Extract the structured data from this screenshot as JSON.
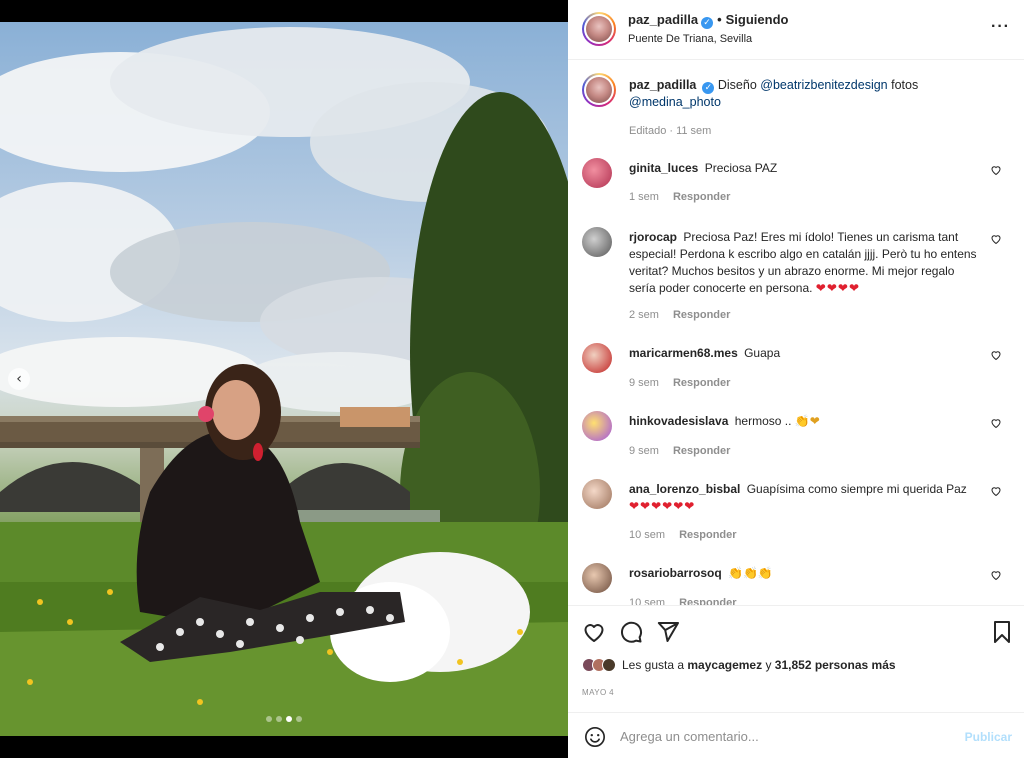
{
  "post": {
    "username": "paz_padilla",
    "following_label": "Siguiendo",
    "location": "Puente De Triana, Sevilla",
    "separator": "•"
  },
  "caption": {
    "username": "paz_padilla",
    "text_pre": "Diseño",
    "mention1": "@beatrizbenitezdesign",
    "text_mid": "fotos",
    "mention2": "@medina_photo",
    "meta": "Editado · 11 sem"
  },
  "comments": [
    {
      "username": "ginita_luces",
      "text": "Preciosa PAZ",
      "extra": "",
      "time": "1 sem",
      "reply": "Responder"
    },
    {
      "username": "rjorocap",
      "text": "Preciosa Paz! Eres mi ídolo! Tienes un carisma tant especial! Perdona k escribo algo en catalán jjjj. Però tu ho entens veritat? Muchos besitos y un abrazo enorme. Mi mejor regalo sería poder conocerte en persona.",
      "extra": "❤❤❤❤",
      "time": "2 sem",
      "reply": "Responder"
    },
    {
      "username": "maricarmen68.mes",
      "text": "Guapa",
      "extra": "",
      "time": "9 sem",
      "reply": "Responder"
    },
    {
      "username": "hinkovadesislava",
      "text": "hermoso ..",
      "extra": "👏❤",
      "time": "9 sem",
      "reply": "Responder"
    },
    {
      "username": "ana_lorenzo_bisbal",
      "text": "Guapísima como siempre mi querida Paz",
      "extra": "❤❤❤❤❤❤",
      "time": "10 sem",
      "reply": "Responder"
    },
    {
      "username": "rosariobarrosoq",
      "text": "",
      "extra": "👏👏👏",
      "time": "10 sem",
      "reply": "Responder"
    }
  ],
  "likes": {
    "prefix": "Les gusta a",
    "user": "maycagemez",
    "middle": "y",
    "count": "31,852 personas más"
  },
  "date": "MAYO 4",
  "comment_box": {
    "placeholder": "Agrega un comentario...",
    "publish_label": "Publicar"
  },
  "icons": {
    "more": "more-icon",
    "like": "heart-icon",
    "comment": "comment-icon",
    "share": "share-icon",
    "save": "bookmark-icon",
    "emoji": "emoji-icon",
    "carousel_prev": "chevron-left-icon"
  },
  "colors": {
    "verified": "#3897f0",
    "link": "#00376b",
    "heart": "#e0202f",
    "publish": "#b2dffc"
  },
  "carousel": {
    "total": 4,
    "active": 3
  }
}
